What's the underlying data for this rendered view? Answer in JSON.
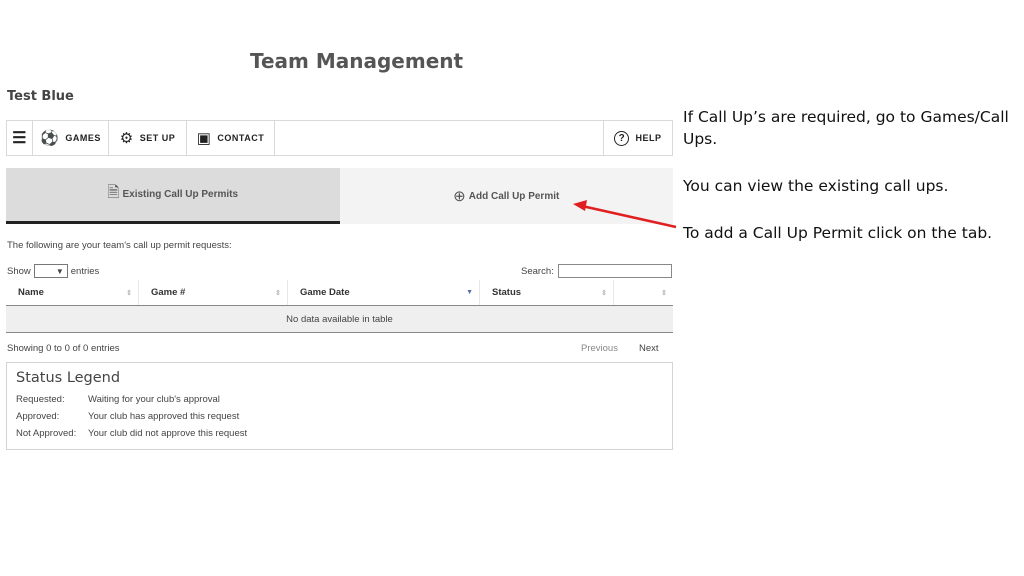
{
  "page_title": "Team Management",
  "team_name": "Test Blue",
  "nav": {
    "menu_icon": "hamburger-icon",
    "items": [
      {
        "label": "GAMES",
        "icon": "soccer-ball-icon"
      },
      {
        "label": "SET UP",
        "icon": "gear-icon"
      },
      {
        "label": "CONTACT",
        "icon": "contact-card-icon"
      }
    ],
    "help": {
      "label": "HELP",
      "icon": "question-circle-icon"
    }
  },
  "tabs": {
    "existing": {
      "label": "Existing Call Up Permits",
      "icon": "document-icon"
    },
    "add": {
      "label": "Add Call Up Permit",
      "icon": "plus-circle-icon"
    }
  },
  "intro": "The following are your team's call up permit requests:",
  "show": {
    "prefix": "Show",
    "suffix": "entries"
  },
  "search": {
    "label": "Search:",
    "value": ""
  },
  "table": {
    "columns": [
      "Name",
      "Game #",
      "Game Date",
      "Status",
      ""
    ],
    "empty_text": "No data available in table"
  },
  "info": "Showing 0 to 0 of 0 entries",
  "pager": {
    "previous": "Previous",
    "next": "Next"
  },
  "legend": {
    "title": "Status Legend",
    "rows": [
      {
        "key": "Requested:",
        "value": "Waiting for your club's approval"
      },
      {
        "key": "Approved:",
        "value": "Your club has approved this request"
      },
      {
        "key": "Not Approved:",
        "value": "Your club did not approve this request"
      }
    ]
  },
  "notes": [
    "If Call Up’s are required, go to Games/Call Ups.",
    "You can view the existing call ups.",
    "To add a Call Up Permit click on the tab."
  ],
  "colors": {
    "arrow": "#e02020",
    "active_tab_border": "#222222"
  }
}
